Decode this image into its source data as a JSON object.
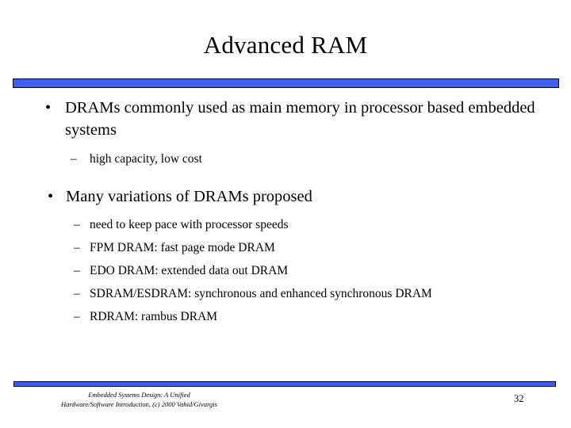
{
  "slide": {
    "title": "Advanced RAM",
    "page_number": "32",
    "accent_color": "#3C5FEE",
    "background_color": "#FFFFFF",
    "text_color": "#000000"
  },
  "decor": {
    "top_bar_name": "top-divider-bar",
    "bottom_bar_name": "bottom-divider-bar"
  },
  "content": {
    "bullet_glyph": "•",
    "dash_glyph": "–",
    "bullet1": {
      "text": "DRAMs commonly used as main memory in processor based embedded systems"
    },
    "bullet1_sub": [
      {
        "text": "high capacity, low cost"
      }
    ],
    "bullet2": {
      "text": "Many variations of DRAMs proposed"
    },
    "bullet2_sub": [
      {
        "text": "need to keep pace with processor speeds"
      },
      {
        "text": "FPM DRAM: fast page mode DRAM"
      },
      {
        "text": "EDO DRAM: extended data out DRAM"
      },
      {
        "text": "SDRAM/ESDRAM: synchronous and enhanced synchronous DRAM"
      },
      {
        "text": "RDRAM: rambus DRAM"
      }
    ]
  },
  "footer": {
    "line1": "Embedded Systems Design: A Unified",
    "line2": "Hardware/Software Introduction, (c) 2000 Vahid/Givargis"
  }
}
